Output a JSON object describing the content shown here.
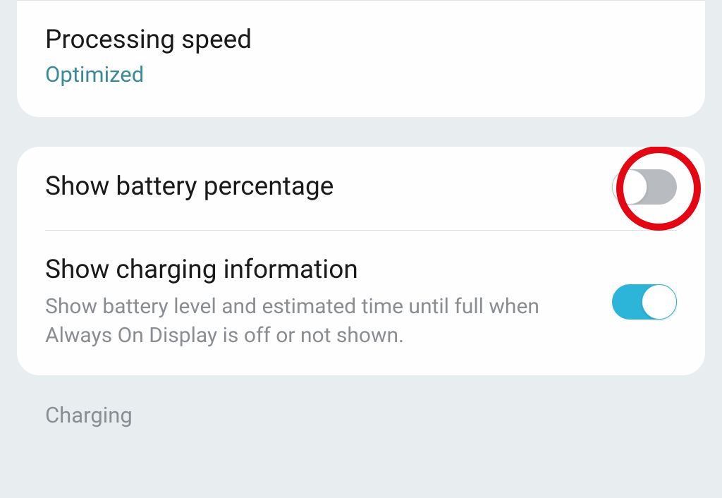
{
  "card1": {
    "processing_speed": {
      "title": "Processing speed",
      "value": "Optimized"
    }
  },
  "card2": {
    "battery_percentage": {
      "title": "Show battery percentage",
      "toggle_state": "off",
      "highlighted": true
    },
    "charging_info": {
      "title": "Show charging information",
      "description": "Show battery level and estimated time until full when Always On Display is off or not shown.",
      "toggle_state": "on"
    }
  },
  "section_header": "Charging"
}
